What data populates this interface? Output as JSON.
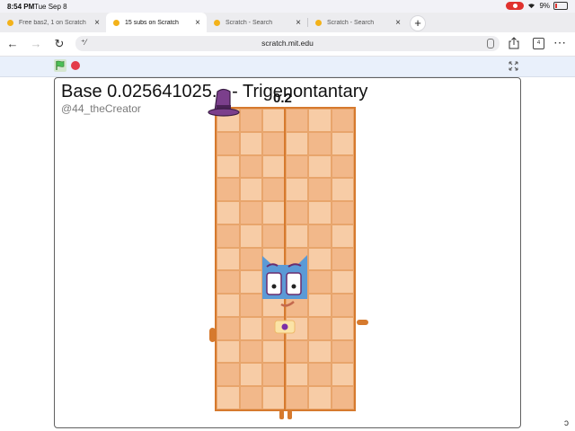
{
  "status_bar": {
    "time": "8:54 PM",
    "date": "Tue Sep 8",
    "battery": "9%"
  },
  "tabs": [
    {
      "title": "Free bas2, 1 on Scratch",
      "active": false
    },
    {
      "title": "15 subs on Scratch",
      "active": true
    },
    {
      "title": "Scratch - Search",
      "active": false
    },
    {
      "title": "Scratch - Search",
      "active": false
    }
  ],
  "toolbar": {
    "url": "scratch.mit.edu",
    "tabs_count": "4"
  },
  "stage": {
    "title": "Base 0.025641025... - Trigenontantary",
    "author": "@44_theCreator",
    "block_label": "0.2"
  },
  "colors": {
    "block_orange": "#d67a2e",
    "block_fill": "#f5c49a",
    "face_blue": "#5b9ad6",
    "stop_red": "#e33b4a"
  }
}
